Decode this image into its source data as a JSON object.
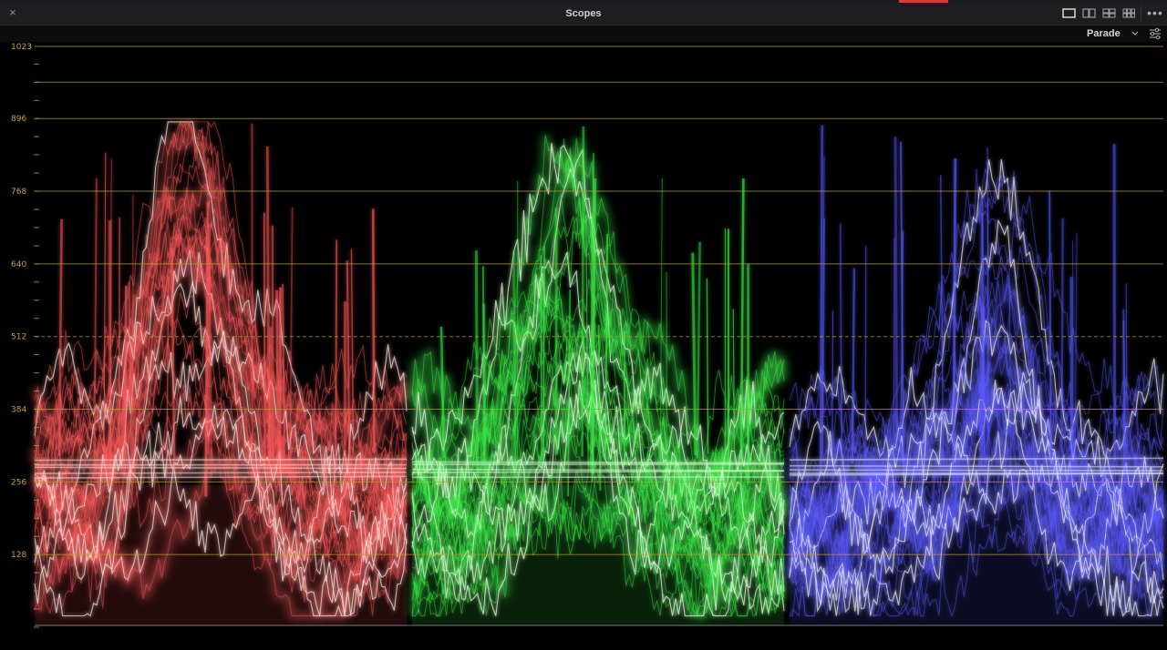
{
  "window": {
    "close_glyph": "×",
    "title": "Scopes",
    "more_glyph": "•••",
    "layouts": [
      "single-view",
      "two-up-view",
      "four-quad-view",
      "multi-grid-view"
    ]
  },
  "toolbar": {
    "mode_label": "Parade",
    "settings_icon": "sliders-icon"
  },
  "scope": {
    "type": "parade",
    "scale": "10-bit",
    "ticks": [
      "1023",
      "896",
      "768",
      "640",
      "512",
      "384",
      "256",
      "128"
    ],
    "dashed_tick": "512",
    "channels": [
      {
        "name": "red",
        "color": "#ff5a5a",
        "core": "#ffd9d4"
      },
      {
        "name": "green",
        "color": "#3ff04a",
        "core": "#d6ffd0"
      },
      {
        "name": "blue",
        "color": "#5a5aff",
        "core": "#e0e0ff"
      }
    ],
    "colors": {
      "grid": "#b89a2e",
      "background": "#000000"
    }
  }
}
